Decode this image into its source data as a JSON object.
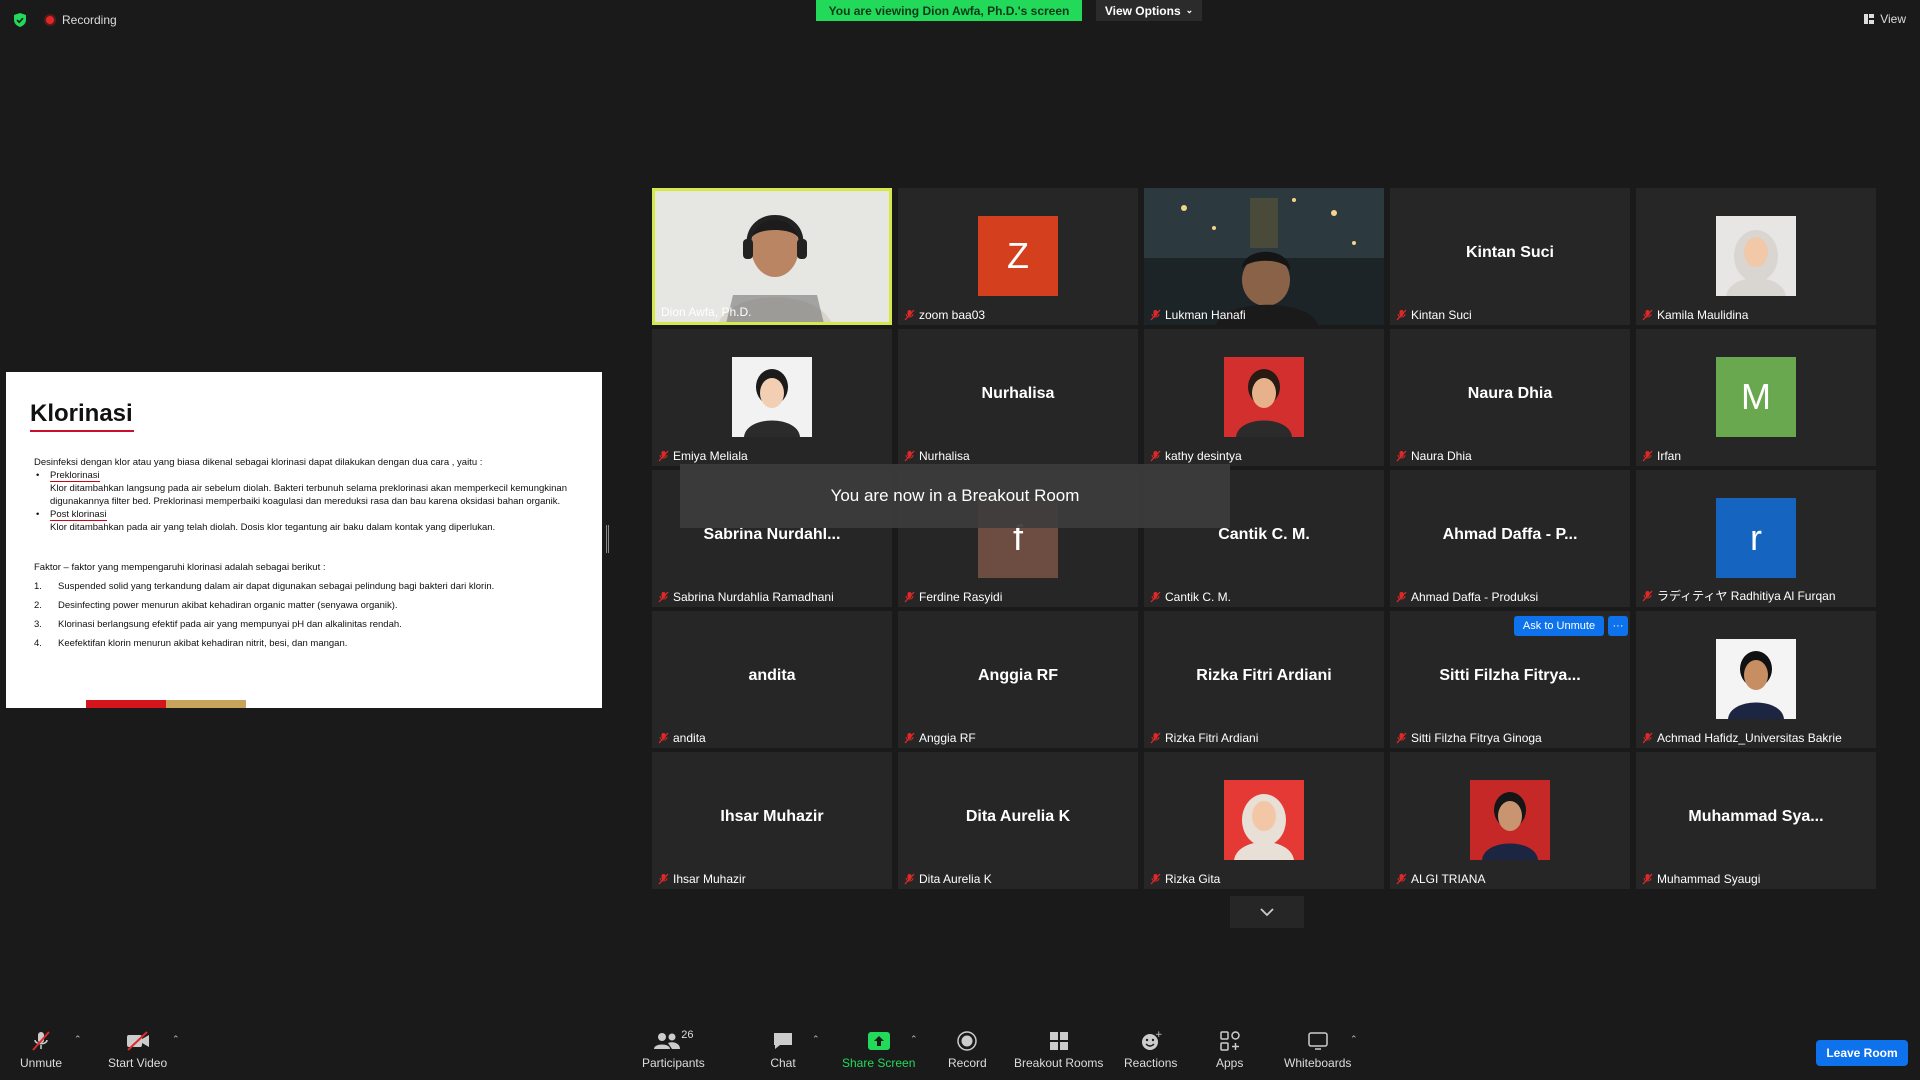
{
  "top": {
    "recording_label": "Recording",
    "viewing_banner": "You are viewing Dion Awfa, Ph.D.'s screen",
    "view_options": "View Options",
    "view_label": "View"
  },
  "slide": {
    "title": "Klorinasi",
    "intro": "Desinfeksi dengan klor atau yang biasa dikenal sebagai klorinasi dapat dilakukan dengan dua cara , yaitu :",
    "bullet1_title": "Preklorinasi",
    "bullet1_text": "Klor ditambahkan langsung pada air sebelum diolah. Bakteri terbunuh selama preklorinasi akan memperkecil kemungkinan digunakannya filter bed. Preklorinasi memperbaiki koagulasi dan mereduksi rasa dan bau karena oksidasi bahan organik.",
    "bullet2_title": "Post klorinasi",
    "bullet2_text": "Klor ditambahkan pada air yang telah diolah. Dosis klor tegantung air baku dalam kontak yang diperlukan.",
    "factors_heading": "Faktor – faktor yang mempengaruhi klorinasi adalah sebagai berikut :",
    "factors": [
      {
        "n": "1.",
        "text": "Suspended solid yang terkandung dalam air dapat digunakan sebagai pelindung bagi bakteri dari klorin."
      },
      {
        "n": "2.",
        "text": "Desinfecting power menurun akibat kehadiran organic matter (senyawa organik)."
      },
      {
        "n": "3.",
        "text": "Klorinasi berlangsung efektif pada air yang mempunyai pH dan alkalinitas rendah."
      },
      {
        "n": "4.",
        "text": "Keefektifan klorin menurun akibat kehadiran nitrit, besi, dan mangan."
      }
    ]
  },
  "participants": [
    {
      "name": "Dion Awfa, Ph.D.",
      "big": "",
      "kind": "video-dion"
    },
    {
      "name": "zoom baa03",
      "big": "",
      "kind": "letter",
      "letter": "Z",
      "color": "#d4401e"
    },
    {
      "name": "Lukman Hanafi",
      "big": "",
      "kind": "video-lukman"
    },
    {
      "name": "Kintan Suci",
      "big": "Kintan Suci",
      "kind": "name"
    },
    {
      "name": "Kamila Maulidina",
      "big": "",
      "kind": "photo-hijab-white"
    },
    {
      "name": "Emiya Meliala",
      "big": "",
      "kind": "photo-woman-white"
    },
    {
      "name": "Nurhalisa",
      "big": "Nurhalisa",
      "kind": "name"
    },
    {
      "name": "kathy desintya",
      "big": "",
      "kind": "photo-woman-red"
    },
    {
      "name": "Naura Dhia",
      "big": "Naura Dhia",
      "kind": "name"
    },
    {
      "name": "Irfan",
      "big": "",
      "kind": "letter",
      "letter": "M",
      "color": "#6aa84f"
    },
    {
      "name": "Sabrina Nurdahlia Ramadhani",
      "big": "Sabrina  Nurdahl...",
      "kind": "name"
    },
    {
      "name": "Ferdine Rasyidi",
      "big": "",
      "kind": "letter",
      "letter": "f",
      "color": "#6d4c41"
    },
    {
      "name": "Cantik C. M.",
      "big": "Cantik C. M.",
      "kind": "name"
    },
    {
      "name": "Ahmad Daffa - Produksi",
      "big": "Ahmad Daffa - P...",
      "kind": "name"
    },
    {
      "name": "ラディティヤ Radhitiya Al Furqan",
      "big": "",
      "kind": "letter",
      "letter": "r",
      "color": "#1565c0"
    },
    {
      "name": "andita",
      "big": "andita",
      "kind": "name"
    },
    {
      "name": "Anggia RF",
      "big": "Anggia RF",
      "kind": "name"
    },
    {
      "name": "Rizka Fitri Ardiani",
      "big": "Rizka Fitri Ardiani",
      "kind": "name"
    },
    {
      "name": "Sitti Filzha Fitrya Ginoga",
      "big": "Sitti Filzha Fitrya...",
      "kind": "name"
    },
    {
      "name": "Achmad Hafidz_Universitas Bakrie",
      "big": "",
      "kind": "photo-man-white"
    },
    {
      "name": "Ihsar Muhazir",
      "big": "Ihsar Muhazir",
      "kind": "name"
    },
    {
      "name": "Dita Aurelia K",
      "big": "Dita Aurelia K",
      "kind": "name"
    },
    {
      "name": "Rizka Gita",
      "big": "",
      "kind": "photo-hijab-red"
    },
    {
      "name": "ALGI TRIANA",
      "big": "",
      "kind": "photo-man-red"
    },
    {
      "name": "Muhammad Syaugi",
      "big": "Muhammad  Sya...",
      "kind": "name"
    }
  ],
  "overlay": {
    "breakout_toast": "You are now in a Breakout Room",
    "ask_unmute": "Ask to Unmute",
    "more": "···"
  },
  "toolbar": {
    "unmute": "Unmute",
    "start_video": "Start Video",
    "participants": "Participants",
    "participants_count": "26",
    "chat": "Chat",
    "share_screen": "Share Screen",
    "record": "Record",
    "breakout_rooms": "Breakout Rooms",
    "reactions": "Reactions",
    "apps": "Apps",
    "whiteboards": "Whiteboards",
    "leave_room": "Leave Room"
  },
  "colors": {
    "share_green": "#23d959",
    "active_speaker": "#d7e84a",
    "leave_blue": "#0e72ed"
  }
}
